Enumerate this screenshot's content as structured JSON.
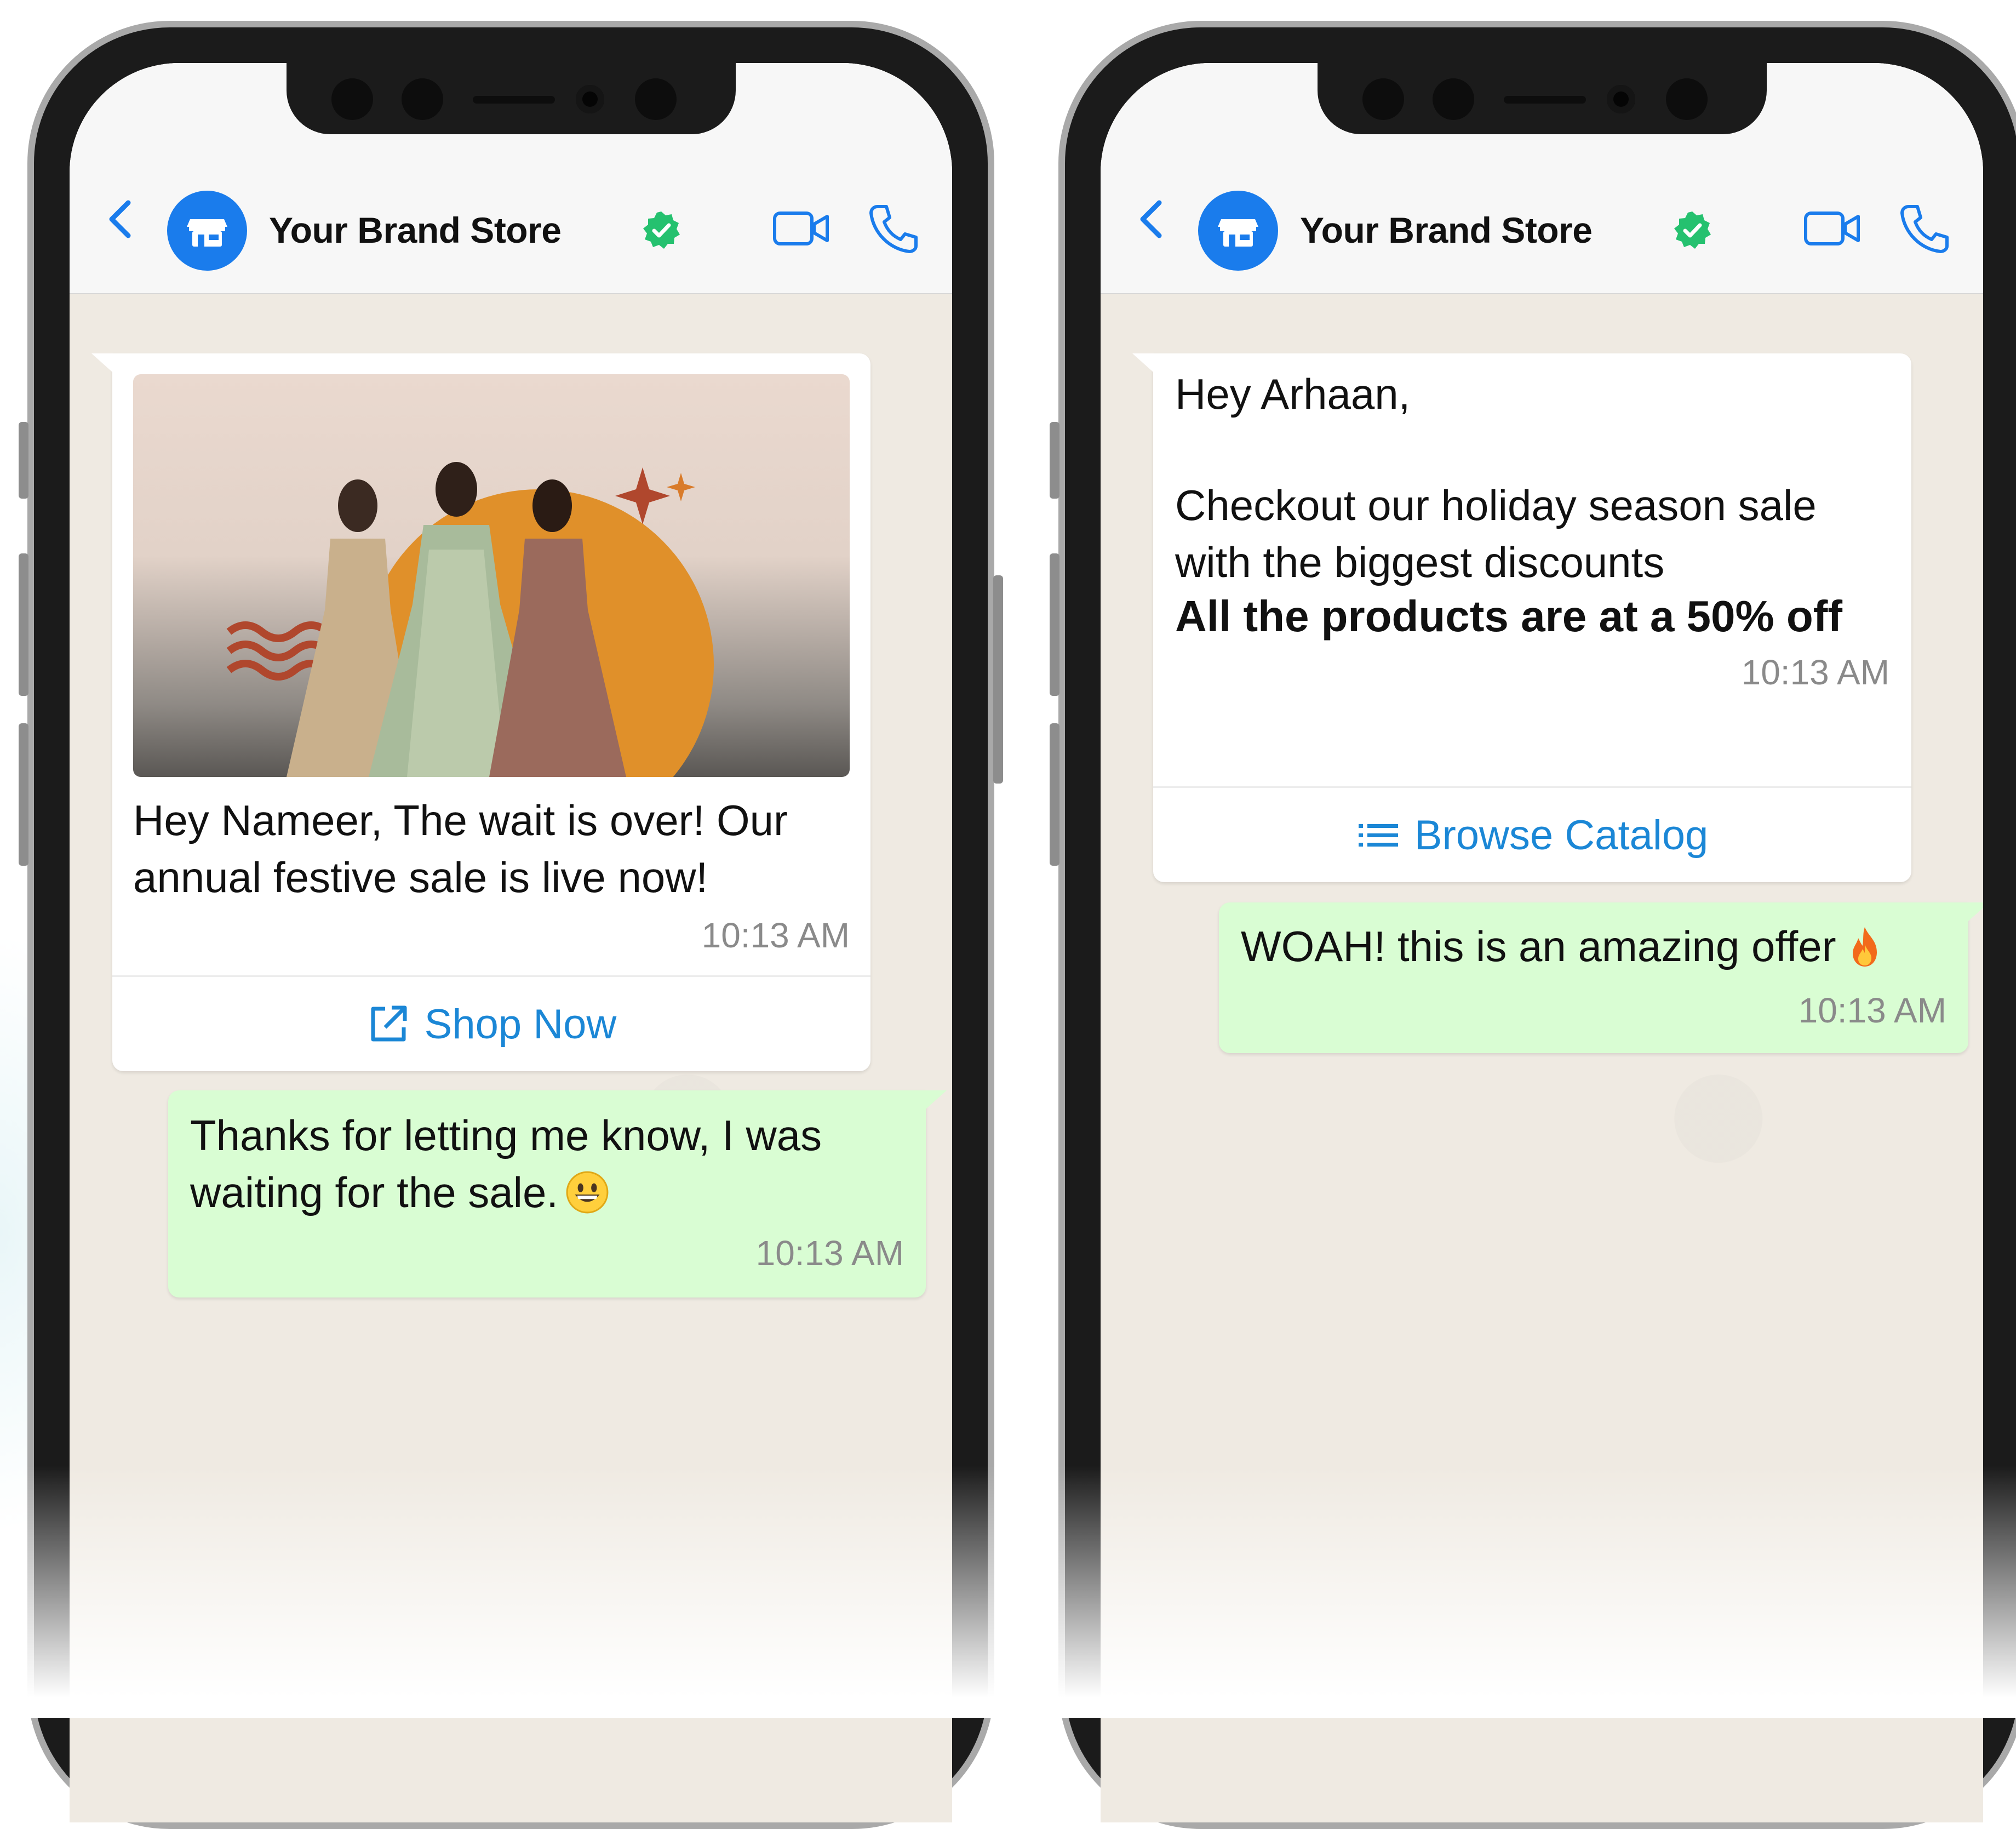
{
  "phones": [
    {
      "header": {
        "title": "Your Brand Store",
        "avatar_icon": "store-icon",
        "back_icon": "chevron-left-icon",
        "verified_icon": "verified-badge-icon",
        "video_icon": "video-camera-icon",
        "call_icon": "phone-icon"
      },
      "messages": [
        {
          "direction": "incoming",
          "image": "fashion-banner-image",
          "text": "Hey Nameer, The wait is over! Our annual festive sale is live now!",
          "time": "10:13 AM",
          "button": {
            "label": "Shop Now",
            "icon": "external-link-icon"
          }
        },
        {
          "direction": "outgoing",
          "text": "Thanks for letting me know, I was waiting for the sale.",
          "emoji": "grinning-face-emoji",
          "time": "10:13 AM"
        }
      ]
    },
    {
      "header": {
        "title": "Your Brand Store",
        "avatar_icon": "store-icon",
        "back_icon": "chevron-left-icon",
        "verified_icon": "verified-badge-icon",
        "video_icon": "video-camera-icon",
        "call_icon": "phone-icon"
      },
      "messages": [
        {
          "direction": "incoming",
          "greeting": "Hey Arhaan,",
          "text": "Checkout our holiday season sale with the biggest discounts",
          "bold_text": "All the products are at a 50% off",
          "time": "10:13 AM",
          "button": {
            "label": "Browse Catalog",
            "icon": "list-icon"
          }
        },
        {
          "direction": "outgoing",
          "text": "WOAH! this is an amazing offer",
          "emoji": "fire-emoji",
          "time": "10:13 AM"
        }
      ]
    }
  ],
  "colors": {
    "accent": "#1a7cec",
    "link": "#1b87d6",
    "verified": "#25c16f",
    "outgoing_bubble": "#d9fdd3",
    "incoming_bubble": "#ffffff",
    "chat_background": "#efeae2"
  }
}
